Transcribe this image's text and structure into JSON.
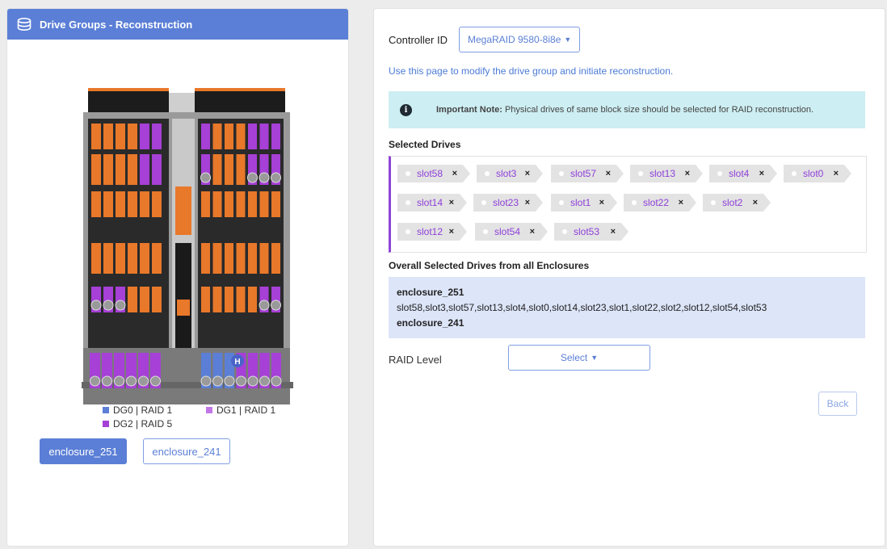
{
  "left_panel": {
    "title": "Drive Groups - Reconstruction",
    "legend": [
      {
        "label": "DG0 | RAID 1",
        "color": "#5b7fd6"
      },
      {
        "label": "DG1 | RAID 1",
        "color": "#c276e6"
      },
      {
        "label": "DG2 | RAID 5",
        "color": "#a640d6"
      }
    ],
    "enclosure_buttons": [
      "enclosure_251",
      "enclosure_241"
    ],
    "active_enclosure": "enclosure_251",
    "enclosure_hotspare_label": "H"
  },
  "controller": {
    "label": "Controller ID",
    "selected": "MegaRAID 9580-8i8e"
  },
  "info_text": "Use this page to modify the drive group and initiate reconstruction.",
  "note": {
    "heading": "Important Note:",
    "text": "Physical drives of same block size should be selected for RAID reconstruction."
  },
  "selected_drives": {
    "title": "Selected Drives",
    "chips": [
      "slot58",
      "slot3",
      "slot57",
      "slot13",
      "slot4",
      "slot0",
      "slot14",
      "slot23",
      "slot1",
      "slot22",
      "slot2",
      "slot12",
      "slot54",
      "slot53"
    ],
    "remove_symbol": "×"
  },
  "overall": {
    "title": "Overall Selected Drives from all Enclosures",
    "enclosures": [
      {
        "name": "enclosure_251",
        "slots": "slot58,slot3,slot57,slot13,slot4,slot0,slot14,slot23,slot1,slot22,slot2,slot12,slot54,slot53"
      },
      {
        "name": "enclosure_241",
        "slots": ""
      }
    ]
  },
  "raid_level": {
    "label": "RAID Level",
    "placeholder": "Select"
  },
  "back_button": "Back",
  "colors": {
    "accent": "#5b7fd6",
    "chip_text": "#8e3fd8",
    "note_bg": "#cdeef2"
  }
}
